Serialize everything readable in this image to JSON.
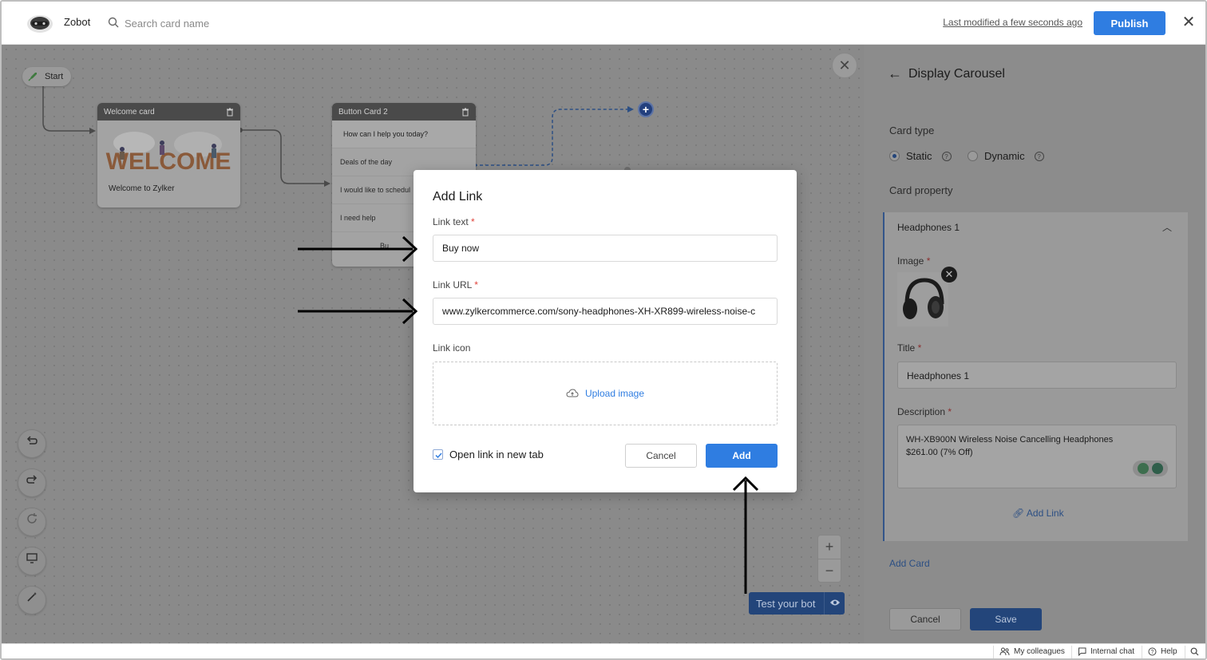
{
  "header": {
    "app_name": "Zobot",
    "search_placeholder": "Search card name",
    "last_modified": "Last modified a few seconds ago",
    "publish_label": "Publish"
  },
  "canvas": {
    "start_label": "Start",
    "welcome_card": {
      "title": "Welcome card",
      "image_text": "WELCOME",
      "caption": "Welcome to Zylker"
    },
    "button_card": {
      "title": "Button Card 2",
      "question": "How can I help you today?",
      "options": [
        "Deals of the day",
        "I would like to schedul",
        "I need help"
      ],
      "footer_text": "Bu"
    },
    "test_bot_label": "Test your bot"
  },
  "panel": {
    "title": "Display Carousel",
    "card_type_label": "Card type",
    "card_type_options": [
      "Static",
      "Dynamic"
    ],
    "card_type_selected": "Static",
    "card_property_label": "Card property",
    "card_name": "Headphones 1",
    "image_label": "Image",
    "title_label": "Title",
    "title_value": "Headphones 1",
    "description_label": "Description",
    "description_line1": "WH-XB900N Wireless Noise Cancelling Headphones",
    "description_line2": "$261.00 (7% Off)",
    "add_link_label": "Add Link",
    "add_card_label": "Add Card",
    "cancel_label": "Cancel",
    "save_label": "Save"
  },
  "modal": {
    "title": "Add Link",
    "link_text_label": "Link text",
    "link_text_value": "Buy now",
    "link_url_label": "Link URL",
    "link_url_value": "www.zylkercommerce.com/sony-headphones-XH-XR899-wireless-noise-c",
    "link_icon_label": "Link icon",
    "upload_label": "Upload image",
    "open_new_tab_label": "Open link in new tab",
    "open_new_tab_checked": true,
    "cancel_label": "Cancel",
    "add_label": "Add",
    "required_mark": "*"
  },
  "footer": {
    "colleagues": "My colleagues",
    "internal_chat": "Internal chat",
    "help": "Help"
  },
  "colors": {
    "accent": "#2f7de1",
    "required": "#e0443c",
    "overlay": "#8a8a8a"
  }
}
